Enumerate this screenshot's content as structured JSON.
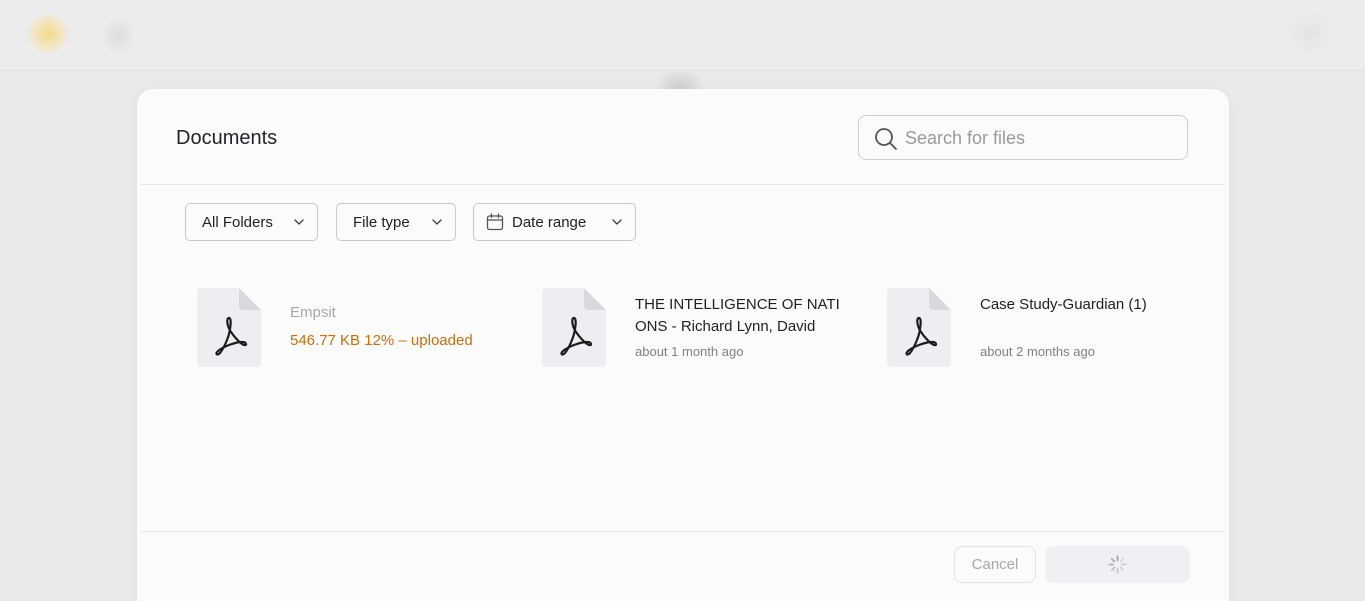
{
  "modal": {
    "title": "Documents",
    "search": {
      "placeholder": "Search for files",
      "value": ""
    },
    "filters": {
      "folders_label": "All Folders",
      "type_label": "File type",
      "date_label": "Date range"
    },
    "files": [
      {
        "name": "Empsit",
        "size": "546.77 KB",
        "progress_text": "12% – uploaded",
        "upload_progress_percent": 12,
        "icon": "pdf-file-icon"
      },
      {
        "name": "THE INTELLIGENCE OF NATI ONS - Richard Lynn, David",
        "date": "about 1 month ago",
        "icon": "pdf-file-icon"
      },
      {
        "name": "Case Study-Guardian (1)",
        "date": "about 2 months ago",
        "icon": "pdf-file-icon"
      }
    ],
    "footer": {
      "cancel_label": "Cancel",
      "submit_state": "loading"
    }
  },
  "colors": {
    "uploading_status": "#c76f0c",
    "modal_background": "#fbfbfb",
    "backdrop": "#e9e9e9"
  }
}
